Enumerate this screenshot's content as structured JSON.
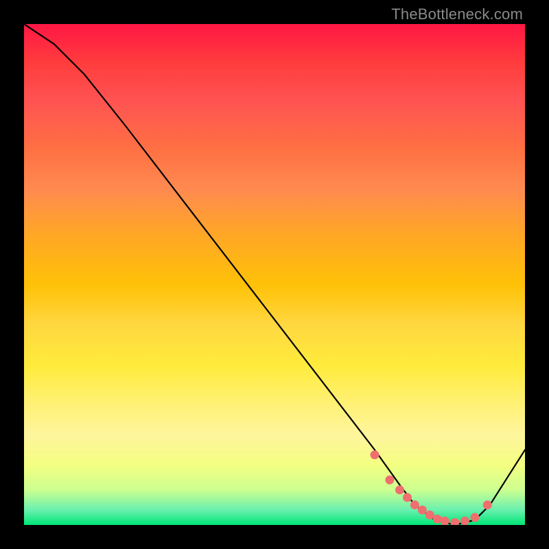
{
  "watermark": "TheBottleneck.com",
  "chart_data": {
    "type": "line",
    "title": "",
    "xlabel": "",
    "ylabel": "",
    "xlim": [
      0,
      100
    ],
    "ylim": [
      0,
      100
    ],
    "series": [
      {
        "name": "bottleneck-curve",
        "x": [
          0,
          6,
          12,
          20,
          30,
          40,
          50,
          60,
          70,
          75,
          78,
          82,
          86,
          90,
          93,
          100
        ],
        "values": [
          100,
          96,
          90,
          80,
          67,
          54,
          41,
          28,
          15,
          8,
          4,
          1,
          0,
          1,
          4,
          15
        ]
      }
    ],
    "dots": {
      "name": "highlight-dots",
      "color": "#ef6f6f",
      "x": [
        70,
        73,
        75,
        76.5,
        78,
        79.5,
        81,
        82.5,
        84,
        86,
        88,
        90,
        92.5
      ],
      "values": [
        14,
        9,
        7,
        5.5,
        4,
        3,
        2,
        1.2,
        0.8,
        0.5,
        0.8,
        1.5,
        4
      ]
    }
  }
}
